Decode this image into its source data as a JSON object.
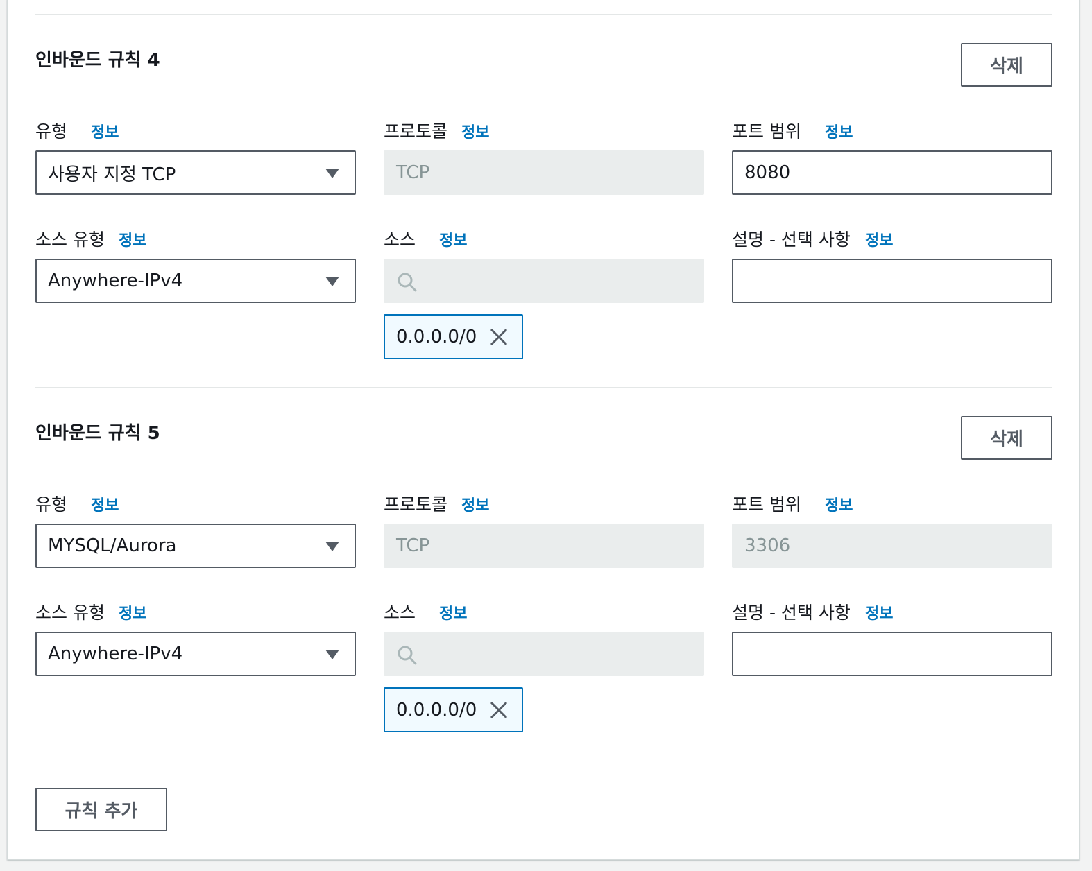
{
  "rules": [
    {
      "title": "인바운드 규칙 4",
      "delete_label": "삭제",
      "type_label": "유형",
      "type_info": "정보",
      "type_value": "사용자 지정 TCP",
      "protocol_label": "프로토콜",
      "protocol_info": "정보",
      "protocol_value": "TCP",
      "port_label": "포트 범위",
      "port_info": "정보",
      "port_value": "8080",
      "source_type_label": "소스 유형",
      "source_type_info": "정보",
      "source_type_value": "Anywhere-IPv4",
      "source_label": "소스",
      "source_info": "정보",
      "source_token": "0.0.0.0/0",
      "description_label": "설명 - 선택 사항",
      "description_info": "정보",
      "description_value": ""
    },
    {
      "title": "인바운드 규칙 5",
      "delete_label": "삭제",
      "type_label": "유형",
      "type_info": "정보",
      "type_value": "MYSQL/Aurora",
      "protocol_label": "프로토콜",
      "protocol_info": "정보",
      "protocol_value": "TCP",
      "port_label": "포트 범위",
      "port_info": "정보",
      "port_value": "3306",
      "source_type_label": "소스 유형",
      "source_type_info": "정보",
      "source_type_value": "Anywhere-IPv4",
      "source_label": "소스",
      "source_info": "정보",
      "source_token": "0.0.0.0/0",
      "description_label": "설명 - 선택 사항",
      "description_info": "정보",
      "description_value": ""
    }
  ],
  "add_rule_label": "규칙 추가",
  "colors": {
    "link": "#0073bb",
    "disabled_bg": "#eaeded",
    "token_bg": "#f1faff",
    "border_dark": "#545b64"
  }
}
